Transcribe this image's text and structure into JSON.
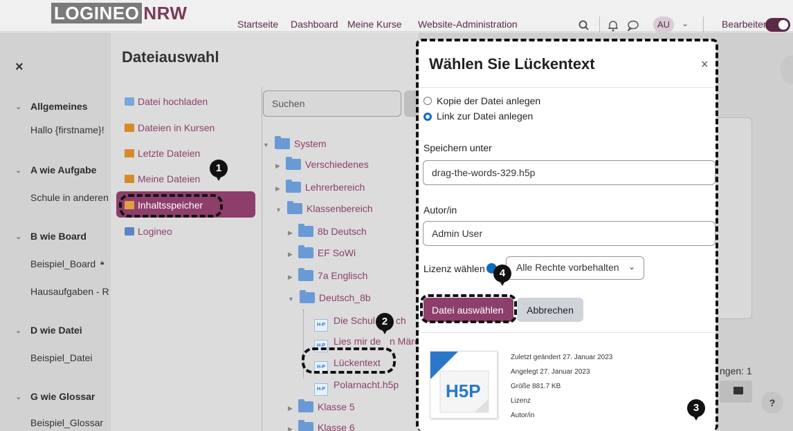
{
  "topnav": {
    "logo_part1": "LOGINEO",
    "logo_part2": "NRW",
    "links": [
      "Startseite",
      "Dashboard",
      "Meine Kurse",
      "Website-Administration"
    ],
    "avatar_initials": "AU",
    "edit_label": "Bearbeiten"
  },
  "sidebar": {
    "close": "×",
    "sections": [
      {
        "title": "Allgemeines",
        "items": [
          "Hallo {firstname}!"
        ]
      },
      {
        "title": "A wie Aufgabe",
        "items": [
          "Schule in anderen"
        ]
      },
      {
        "title": "B wie Board",
        "items": [
          "Beispiel_Board",
          "Hausaufgaben - R"
        ]
      },
      {
        "title": "D wie Datei",
        "items": [
          "Beispiel_Datei"
        ]
      },
      {
        "title": "G wie Glossar",
        "items": [
          "Beispiel_Glossar"
        ]
      }
    ]
  },
  "picker": {
    "title": "Dateiauswahl",
    "repositories": [
      "Datei hochladen",
      "Dateien in Kursen",
      "Letzte Dateien",
      "Meine Dateien",
      "Inhaltsspeicher",
      "Logineo"
    ],
    "search_placeholder": "Suchen",
    "tree": {
      "root": "System",
      "level1": [
        "Verschiedenes",
        "Lehrerbereich",
        "Klassenbereich"
      ],
      "level2": [
        "8b Deutsch",
        "EF SoWi",
        "7a Englisch",
        "Deutsch_8b",
        "Klasse 5",
        "Klasse 6"
      ],
      "files": [
        "Die Schul",
        "ch",
        "Lies mir de",
        "n Märc",
        "Lückentext",
        "Polarnacht.h5p"
      ]
    }
  },
  "dialog": {
    "title": "Wählen Sie Lückentext",
    "close": "×",
    "radio_copy": "Kopie der Datei anlegen",
    "radio_link": "Link zur Datei anlegen",
    "save_as_label": "Speichern unter",
    "save_as_value": "drag-the-words-329.h5p",
    "author_label": "Autor/in",
    "author_value": "Admin User",
    "license_label": "Lizenz wählen",
    "license_value": "Alle Rechte vorbehalten",
    "btn_select": "Datei auswählen",
    "btn_cancel": "Abbrechen",
    "thumb_label": "H5P",
    "meta": [
      "Zuletzt geändert 27. Januar 2023",
      "Angelegt 27. Januar 2023",
      "Größe 881.7 KB",
      "Lizenz",
      "Autor/in"
    ]
  },
  "background": {
    "right_text": "ngen: 1",
    "help": "?"
  },
  "callouts": [
    "1",
    "2",
    "3",
    "4"
  ]
}
